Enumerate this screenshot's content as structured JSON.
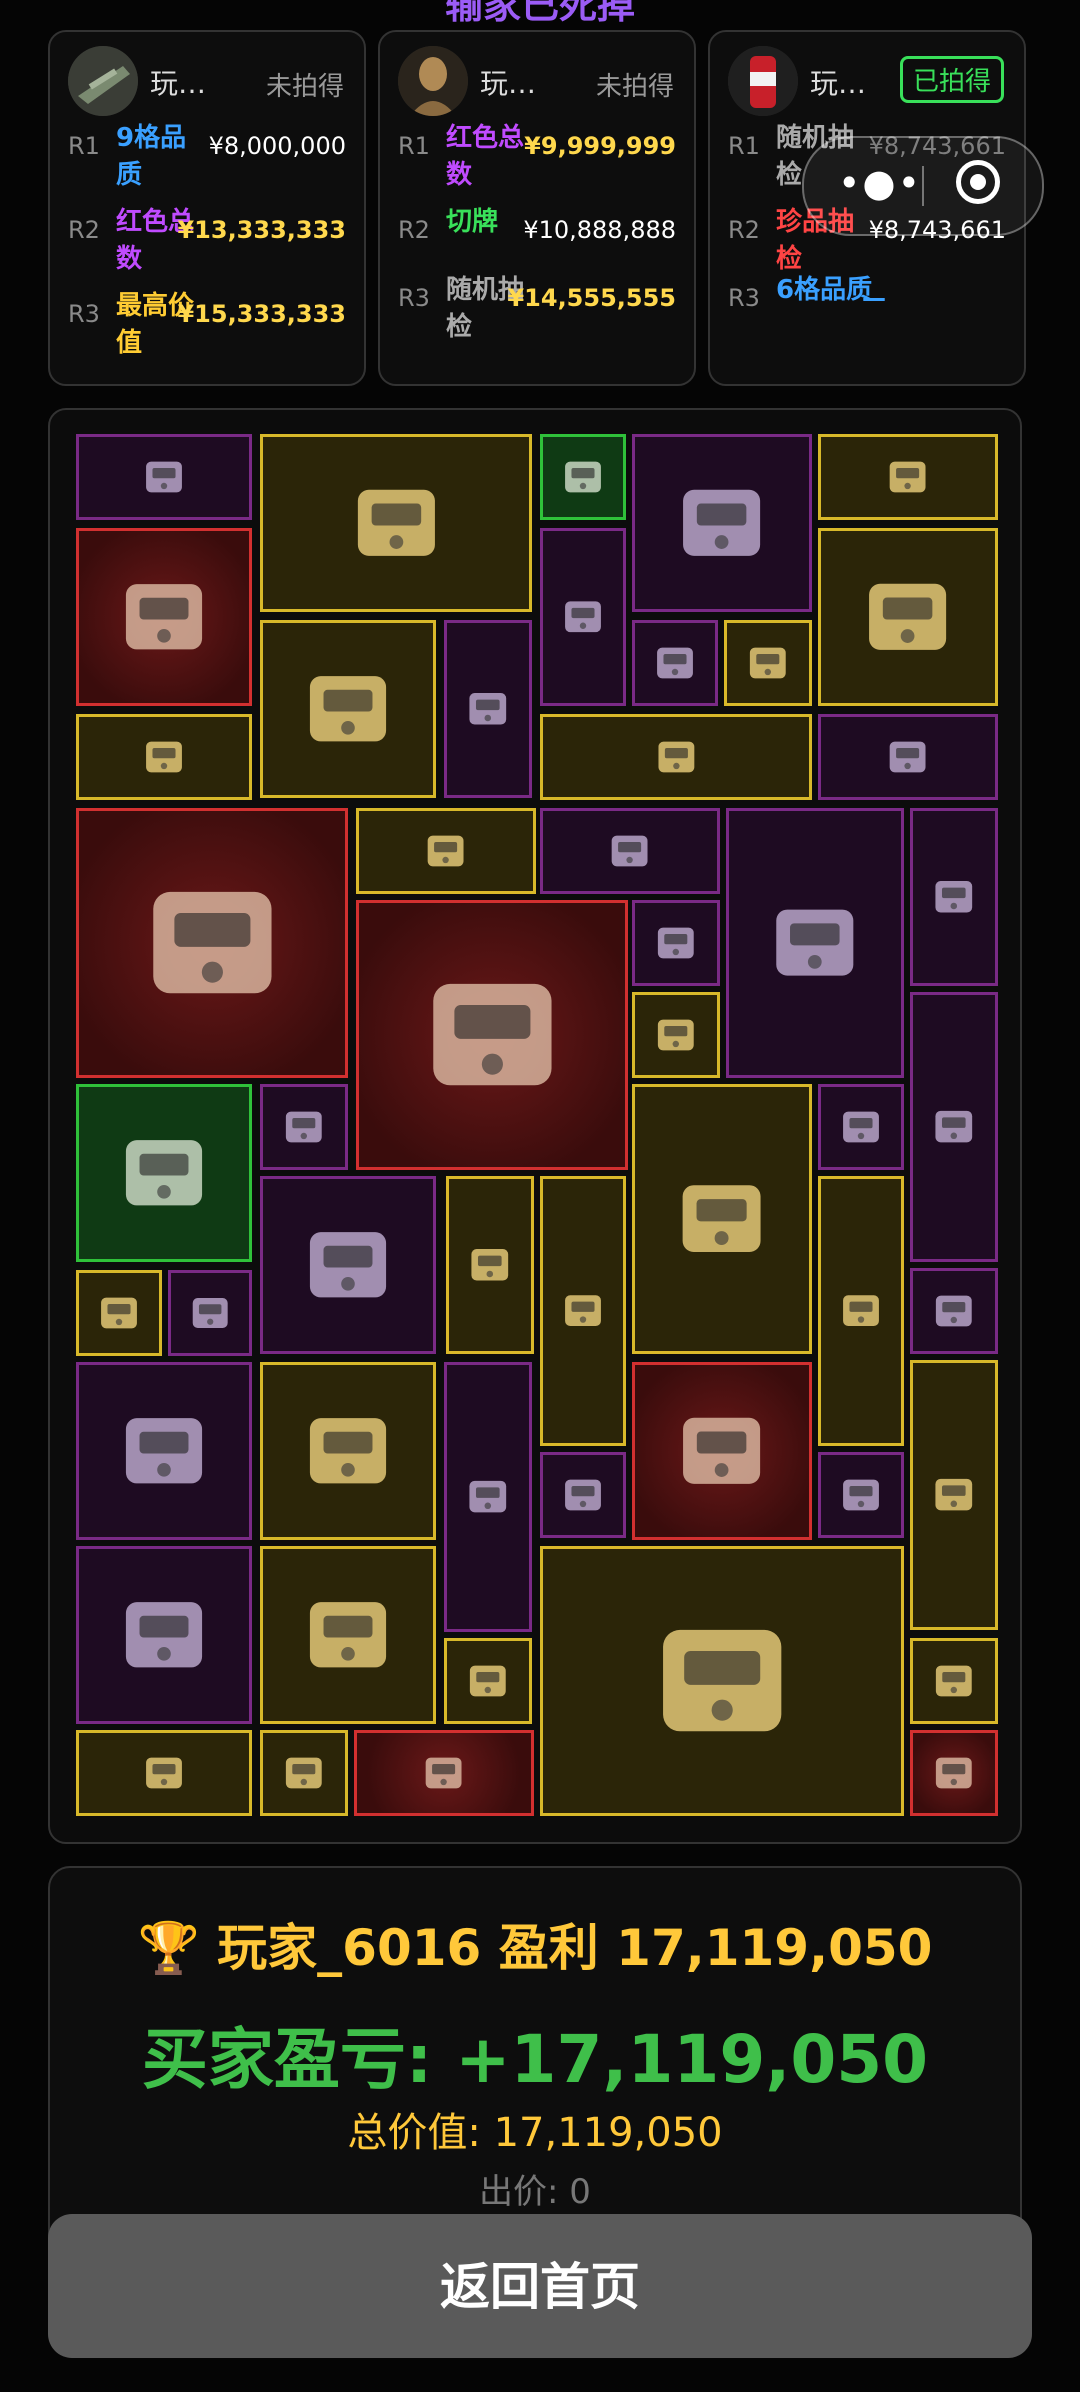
{
  "header": {
    "title": "输家已死掉"
  },
  "capsule": {
    "more_icon": "more-dots-icon",
    "close_icon": "target-circle-icon"
  },
  "players": [
    {
      "name": "玩…",
      "status": "未拍得",
      "won": false,
      "avatar_icon": "weapon-avatar",
      "rows": [
        {
          "rank": "R1",
          "label": "9格品质",
          "label_color": "#3aa0ff",
          "price": "¥8,000,000",
          "highlight": false
        },
        {
          "rank": "R2",
          "label": "红色总数",
          "label_color": "#c04bff",
          "price": "¥13,333,333",
          "highlight": true
        },
        {
          "rank": "R3",
          "label": "最高价值",
          "label_color": "#ffcc33",
          "price": "¥15,333,333",
          "highlight": true
        }
      ]
    },
    {
      "name": "玩…",
      "status": "未拍得",
      "won": false,
      "avatar_icon": "bust-avatar",
      "rows": [
        {
          "rank": "R1",
          "label": "红色总数",
          "label_color": "#c04bff",
          "price": "¥9,999,999",
          "highlight": true
        },
        {
          "rank": "R2",
          "label": "切牌",
          "label_color": "#39e05a",
          "price": "¥10,888,888",
          "highlight": false
        },
        {
          "rank": "R3",
          "label": "随机抽检",
          "label_color": "#aaaaaa",
          "price": "¥14,555,555",
          "highlight": true
        }
      ]
    },
    {
      "name": "玩…",
      "status": "已拍得",
      "won": true,
      "avatar_icon": "cola-can-avatar",
      "rows": [
        {
          "rank": "R1",
          "label": "随机抽检",
          "label_color": "#aaaaaa",
          "price": "¥8,743,661",
          "highlight": false
        },
        {
          "rank": "R2",
          "label": "珍品抽检",
          "label_color": "#ff4444",
          "price": "¥8,743,661",
          "highlight": false
        },
        {
          "rank": "R3",
          "label": "6格品质",
          "label_color": "#3aa0ff",
          "price": "—",
          "highlight": false
        }
      ]
    }
  ],
  "result": {
    "winner": "🏆 玩家_6016 盈利 17,119,050",
    "profit": "买家盈亏: +17,119,050",
    "total": "总价值: 17,119,050",
    "bid": "出价: 0"
  },
  "home_button": {
    "label": "返回首页"
  },
  "colors": {
    "gold_border": "#d8b92a",
    "purple_border": "#7a2a86",
    "red_border": "#d23030",
    "green_border": "#2fc13a",
    "profit_green": "#3fbf4a",
    "winner_gold": "#ffc83a"
  },
  "items": [
    {
      "name": "horned-skull-item",
      "rarity": "purple"
    },
    {
      "name": "radio-station-item",
      "rarity": "gold"
    },
    {
      "name": "apple-item",
      "rarity": "green"
    },
    {
      "name": "coffee-machine-item",
      "rarity": "purple"
    },
    {
      "name": "device-item",
      "rarity": "gold"
    },
    {
      "name": "tablet-case-item",
      "rarity": "red"
    },
    {
      "name": "pliers-item",
      "rarity": "purple"
    },
    {
      "name": "id-card-item",
      "rarity": "gold"
    },
    {
      "name": "ammo-box-item",
      "rarity": "gold"
    },
    {
      "name": "black-tide-book-item",
      "rarity": "purple"
    },
    {
      "name": "ram-stick-item",
      "rarity": "purple"
    },
    {
      "name": "inhaler-item",
      "rarity": "gold"
    },
    {
      "name": "gold-chain-item",
      "rarity": "gold"
    },
    {
      "name": "red-case-item",
      "rarity": "gold"
    },
    {
      "name": "armor-plate-item",
      "rarity": "purple"
    },
    {
      "name": "reactor-core-item",
      "rarity": "red"
    },
    {
      "name": "gold-chain-item",
      "rarity": "gold"
    },
    {
      "name": "armor-plate-item",
      "rarity": "purple"
    },
    {
      "name": "moon-lamp-item",
      "rarity": "purple"
    },
    {
      "name": "golden-dagger-item",
      "rarity": "purple"
    },
    {
      "name": "gpu-card-item",
      "rarity": "red"
    },
    {
      "name": "tube-item",
      "rarity": "purple"
    },
    {
      "name": "camera-item",
      "rarity": "gold"
    },
    {
      "name": "lantern-item",
      "rarity": "purple"
    },
    {
      "name": "angle-grinder-item",
      "rarity": "green"
    },
    {
      "name": "cassette-item",
      "rarity": "purple"
    },
    {
      "name": "power-bank-item",
      "rarity": "gold"
    },
    {
      "name": "knife-item",
      "rarity": "purple"
    },
    {
      "name": "porcelain-cup-item",
      "rarity": "gold"
    },
    {
      "name": "ram-stick-item",
      "rarity": "purple"
    },
    {
      "name": "pipe-scanner-item",
      "rarity": "purple"
    },
    {
      "name": "document-item",
      "rarity": "gold"
    },
    {
      "name": "oxygen-tank-item",
      "rarity": "gold"
    },
    {
      "name": "tube-container-item",
      "rarity": "gold"
    },
    {
      "name": "notebook-item",
      "rarity": "purple"
    },
    {
      "name": "pipe-scanner-item",
      "rarity": "purple"
    },
    {
      "name": "id-card-item",
      "rarity": "gold"
    },
    {
      "name": "lantern-item",
      "rarity": "purple"
    },
    {
      "name": "notebook-item",
      "rarity": "purple"
    },
    {
      "name": "armillary-sphere-item",
      "rarity": "red"
    },
    {
      "name": "notebook-item",
      "rarity": "purple"
    },
    {
      "name": "tube-container-item",
      "rarity": "gold"
    },
    {
      "name": "pipe-scanner-item",
      "rarity": "purple"
    },
    {
      "name": "ammo-box-item",
      "rarity": "gold"
    },
    {
      "name": "server-rack-item",
      "rarity": "gold"
    },
    {
      "name": "orb-drone-item",
      "rarity": "gold"
    },
    {
      "name": "orb-drone-item",
      "rarity": "gold"
    },
    {
      "name": "sunglasses-item",
      "rarity": "gold"
    },
    {
      "name": "drill-bit-item",
      "rarity": "gold"
    },
    {
      "name": "green-tablet-item",
      "rarity": "red"
    },
    {
      "name": "servo-item",
      "rarity": "red"
    }
  ]
}
